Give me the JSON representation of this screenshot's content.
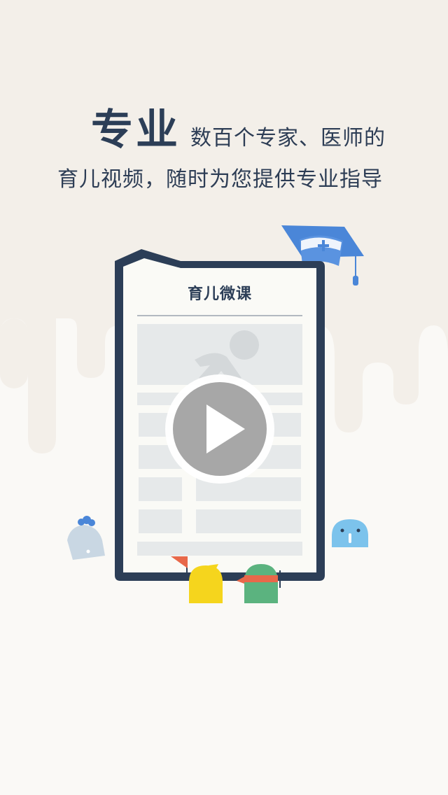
{
  "headline": {
    "big": "专业",
    "small": "数百个专家、医师的",
    "subline": "育儿视频，随时为您提供专业指导"
  },
  "card": {
    "title": "育儿微课"
  },
  "colors": {
    "background": "#faf9f6",
    "drip": "#f3efe9",
    "navy": "#2c3e57",
    "accent_blue": "#4a86d8",
    "yellow": "#f5d51d",
    "green": "#5bb37f"
  },
  "icons": {
    "play": "play-icon",
    "graduation_cap": "graduation-cap-icon"
  }
}
